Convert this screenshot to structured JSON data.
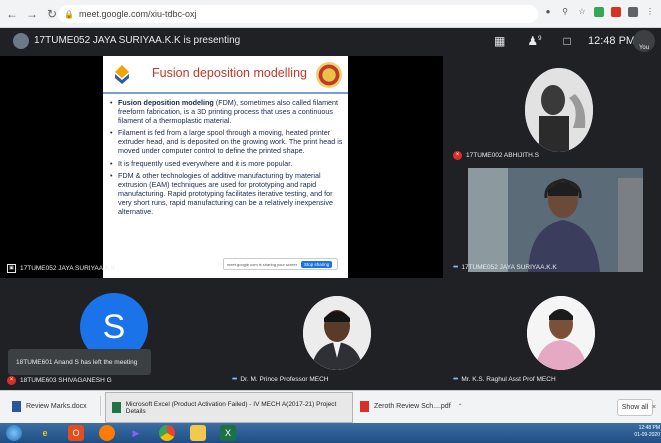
{
  "browser": {
    "url": "meet.google.com/xiu-tdbc-oxj",
    "back_icon": "arrow-left-icon",
    "forward_icon": "arrow-right-icon",
    "reload_icon": "reload-icon",
    "lock_icon": "lock-icon"
  },
  "meet": {
    "presenting_text": "17TUME052 JAYA SURIYAA.K.K is presenting",
    "clock": "12:48 PM",
    "participant_count_badge": "9",
    "you_label": "You"
  },
  "slide": {
    "title": "Fusion deposition modelling",
    "bullets": [
      {
        "bold": "Fusion deposition modeling",
        "rest": " (FDM), sometimes also called filament freeform fabrication, is a 3D printing process that uses a continuous filament of a thermoplastic material."
      },
      {
        "bold": "",
        "rest": "Filament is fed from a large spool through a moving, heated printer extruder head, and is deposited on the growing work. The print head is moved under computer control to define the printed shape."
      },
      {
        "bold": "",
        "rest": "It is frequently used everywhere and it is more popular."
      },
      {
        "bold": "",
        "rest": "FDM & other technologies of additive manufacturing by material extrusion (EAM) techniques are used for prototyping and rapid manufacturing. Rapid prototyping facilitates iterative testing, and for very short runs, rapid manufacturing can be a relatively inexpensive alternative."
      }
    ],
    "sharing_message": "meet.google.com is sharing your screen.",
    "stop_sharing_label": "Stop sharing"
  },
  "tiles": {
    "presenter_label": "17TUME052 JAYA SURIYAA.K.K",
    "abhijith_label": "17TUME002 ABHIJITH.S",
    "jaya_video_label": "17TUME052 JAYA SURIYAA.K.K",
    "shivaganesh_label": "18TUME603 SHIVAGANESH G",
    "shivaganesh_initial": "S",
    "prince_label": "Dr. M. Prince Professor MECH",
    "raghul_label": "Mr. K.S. Raghul Asst Prof MECH"
  },
  "toast": {
    "text": "18TUME601 Anand S has left the meeting"
  },
  "downloads": {
    "items": [
      {
        "name": "Review Marks.docx",
        "type": "word"
      },
      {
        "name": "Zeroth Review Sch....pdf",
        "type": "pdf"
      }
    ],
    "excel_tooltip": "Microsoft Excel (Product Activation Failed) - IV MECH A(2017-21) Project Details",
    "show_all_label": "Show all"
  },
  "taskbar": {
    "time": "12:48 PM",
    "date": "01-09-2020",
    "apps": [
      "windows-start-icon",
      "ie-icon",
      "office-icon",
      "firefox-icon",
      "media-player-icon",
      "chrome-icon",
      "explorer-icon",
      "excel-icon"
    ]
  },
  "colors": {
    "meet_bg": "#202124",
    "slide_title": "#c0392b",
    "slide_text": "#1b2a55",
    "avatar_blue": "#1a73e8",
    "mic_off_red": "#d93025"
  }
}
